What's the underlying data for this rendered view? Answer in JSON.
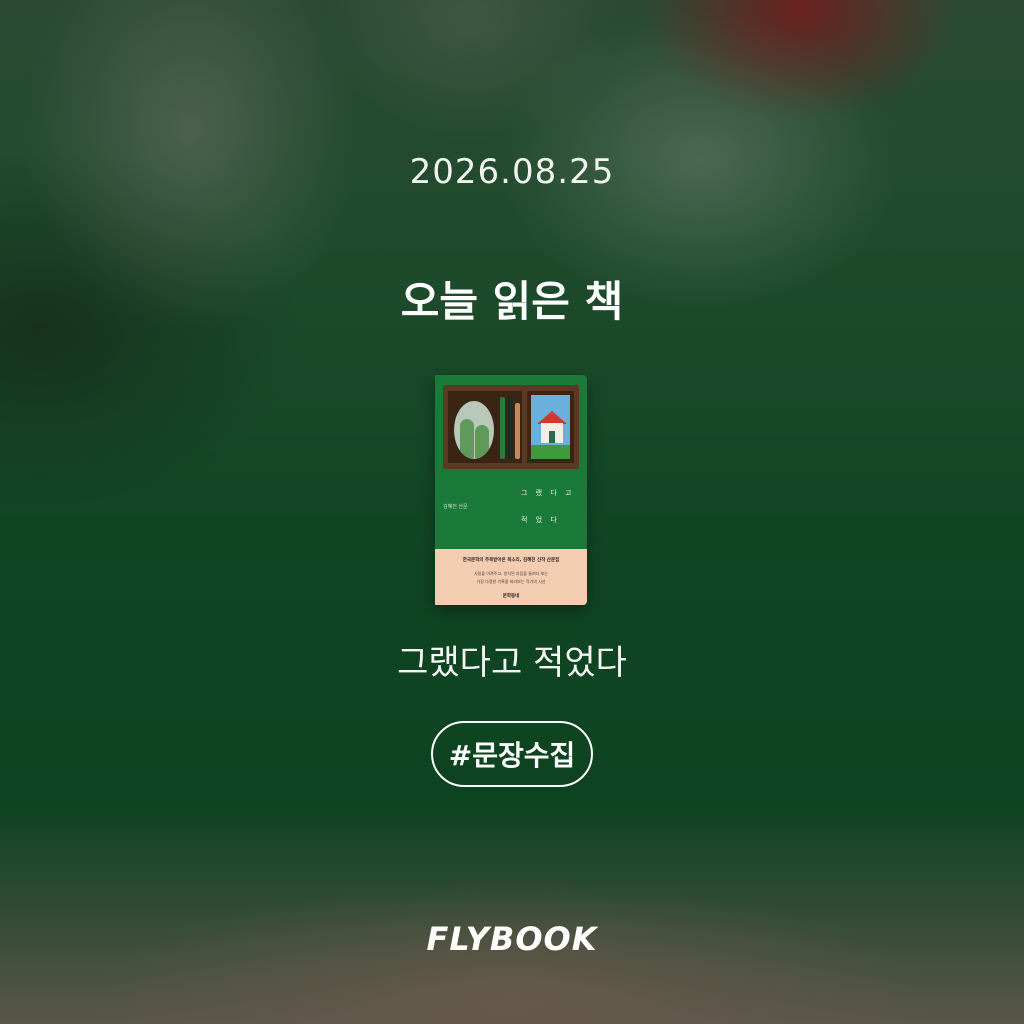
{
  "date": "2026.08.25",
  "headline": "오늘 읽은 책",
  "book": {
    "title": "그랬다고 적었다",
    "cover": {
      "title_line_1": "그 랬 다 고",
      "title_line_2": "적 었 다",
      "author": "김혜진 산문",
      "band_headline": "한국문학의 주목받아온 목소리, 김혜진 신작 산문집",
      "band_line_1": "사람을 아껴주고, 방치된 마음을 들여다 보는",
      "band_line_2": "가장 다정한 기록을 바라보는 작가의 시선",
      "publisher": "문학동네"
    }
  },
  "tag": "#문장수집",
  "brand": "FLYBOOK"
}
